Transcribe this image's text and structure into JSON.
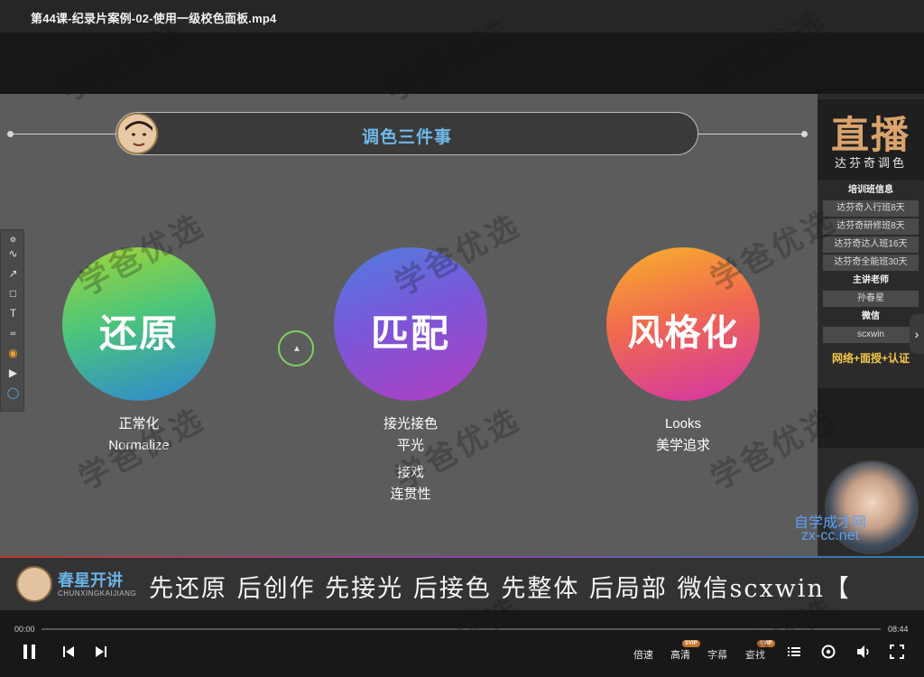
{
  "window": {
    "title": "第44课-纪录片案例-02-使用一级校色面板.mp4"
  },
  "slide": {
    "title": "调色三件事",
    "items": [
      {
        "heading": "还原",
        "lines": [
          "正常化",
          "Normalize"
        ]
      },
      {
        "heading": "匹配",
        "lines": [
          "接光接色",
          "平光"
        ],
        "extra": [
          "接戏",
          "连贯性"
        ]
      },
      {
        "heading": "风格化",
        "lines": [
          "Looks",
          "美学追求"
        ]
      }
    ],
    "tool_icons": [
      "settings-icon",
      "lasso-icon",
      "arrow-icon",
      "rectangle-icon",
      "text-icon",
      "link-icon",
      "color-wheel-icon",
      "play-icon",
      "circle-tool-icon"
    ]
  },
  "live_panel": {
    "big": "直播",
    "small": "达芬奇调色",
    "training_header": "培训班信息",
    "courses": [
      "达芬奇入行班8天",
      "达芬奇研修班8天",
      "达芬奇达人班16天",
      "达芬奇全能班30天"
    ],
    "teacher_header": "主讲老师",
    "teacher": "孙春星",
    "wechat_header": "微信",
    "wechat": "scxwin",
    "footer": "网络+面授+认证"
  },
  "watermark": {
    "line1": "自学成才网",
    "line2": "zx-cc.net",
    "repeat": "学爸优选"
  },
  "ticker": {
    "brand": "春星开讲",
    "brand_en": "CHUNXINGKAIJIANG",
    "message": "先还原 后创作 先接光 后接色 先整体 后局部 微信scxwin【"
  },
  "player": {
    "current_time": "00:00",
    "total_time": "08:44",
    "progress": 0.0,
    "speed_label": "倍速",
    "quality_label": "高清",
    "subtitle_label": "字幕",
    "search_label": "查找",
    "svip_badge": "SVIP"
  },
  "colors": {
    "title_blue": "#6fb8e6",
    "footer_yellow": "#f3c64a",
    "live_gold": "#d9a36b"
  }
}
